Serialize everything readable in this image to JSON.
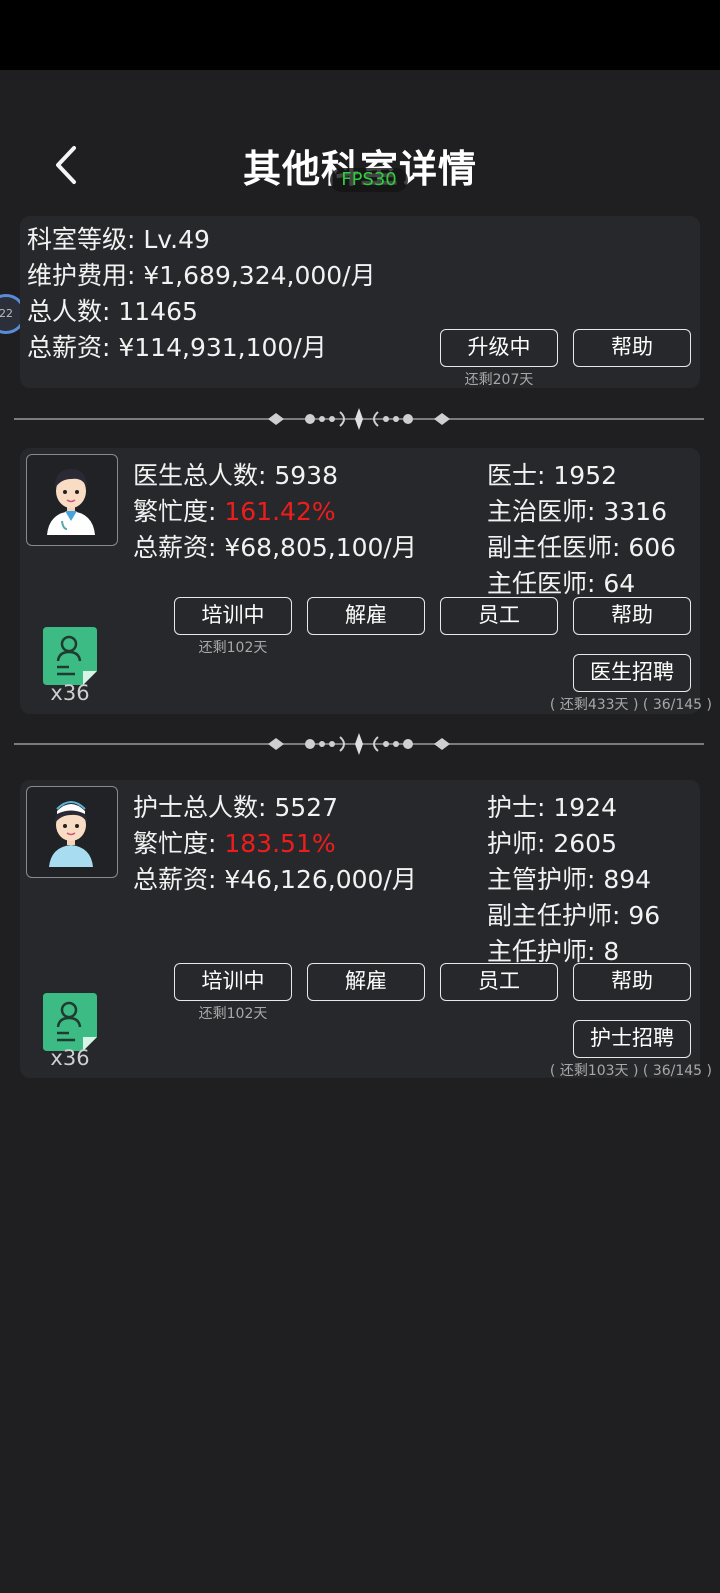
{
  "header": {
    "title": "其他科室详情",
    "fps": "FPS30"
  },
  "side_badge": "22",
  "summary": {
    "level": "科室等级: Lv.49",
    "maintenance": "维护费用: ¥1,689,324,000/月",
    "staff_total": "总人数: 11465",
    "salary_total": "总薪资: ¥114,931,100/月",
    "upgrade_button": "升级中",
    "upgrade_remaining": "还剩207天",
    "help_button": "帮助"
  },
  "doctors": {
    "total": "医生总人数: 5938",
    "busy_label": "繁忙度: ",
    "busy_value": "161.42%",
    "salary": "总薪资: ¥68,805,100/月",
    "ranks": [
      "医士: 1952",
      "主治医师: 3316",
      "副主任医师: 606",
      "主任医师: 64"
    ],
    "buttons": {
      "train": "培训中",
      "fire": "解雇",
      "staff": "员工",
      "help": "帮助",
      "recruit": "医生招聘"
    },
    "train_remaining": "还剩102天",
    "resume_count": "x36",
    "recruit_info": "( 还剩433天 ) ( 36/145 )"
  },
  "nurses": {
    "total": "护士总人数: 5527",
    "busy_label": "繁忙度: ",
    "busy_value": "183.51%",
    "salary": "总薪资: ¥46,126,000/月",
    "ranks": [
      "护士: 1924",
      "护师: 2605",
      "主管护师: 894",
      "副主任护师: 96",
      "主任护师: 8"
    ],
    "buttons": {
      "train": "培训中",
      "fire": "解雇",
      "staff": "员工",
      "help": "帮助",
      "recruit": "护士招聘"
    },
    "train_remaining": "还剩102天",
    "resume_count": "x36",
    "recruit_info": "( 还剩103天 ) ( 36/145 )"
  },
  "colors": {
    "busy": "#ee1d1d",
    "resume_icon": "#3dbb85",
    "fps": "#2ecc40"
  }
}
